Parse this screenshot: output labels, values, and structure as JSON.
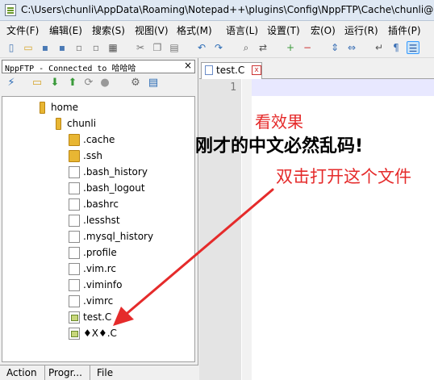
{
  "window": {
    "title": "C:\\Users\\chunli\\AppData\\Roaming\\Notepad++\\plugins\\Config\\NppFTP\\Cache\\chunli@1"
  },
  "menu": [
    "文件(F)",
    "编辑(E)",
    "搜索(S)",
    "视图(V)",
    "格式(M)",
    "语言(L)",
    "设置(T)",
    "宏(O)",
    "运行(R)",
    "插件(P)"
  ],
  "toolbar_icons": [
    "new-file-icon",
    "open-file-icon",
    "save-icon",
    "save-all-icon",
    "close-icon",
    "close-all-icon",
    "print-icon",
    "cut-icon",
    "copy-icon",
    "paste-icon",
    "undo-icon",
    "redo-icon",
    "find-icon",
    "replace-icon",
    "zoom-in-icon",
    "zoom-out-icon",
    "sync-vertical-icon",
    "sync-horizontal-icon",
    "word-wrap-icon",
    "show-all-chars-icon",
    "indent-guide-icon"
  ],
  "ftp_panel": {
    "title": "NppFTP - Connected to 哈哈哈",
    "close_glyph": "×",
    "toolbar_icons": [
      "connect-icon",
      "folder-open-icon",
      "download-icon",
      "upload-icon",
      "refresh-icon",
      "abort-icon",
      "settings-icon",
      "messages-icon"
    ],
    "tree": [
      {
        "label": "home",
        "kind": "folder",
        "depth": 0
      },
      {
        "label": "chunli",
        "kind": "folder",
        "depth": 1
      },
      {
        "label": ".cache",
        "kind": "folder",
        "depth": 2
      },
      {
        "label": ".ssh",
        "kind": "folder",
        "depth": 2
      },
      {
        "label": ".bash_history",
        "kind": "file",
        "depth": 2
      },
      {
        "label": ".bash_logout",
        "kind": "file",
        "depth": 2
      },
      {
        "label": ".bashrc",
        "kind": "file",
        "depth": 2
      },
      {
        "label": ".lesshst",
        "kind": "file",
        "depth": 2
      },
      {
        "label": ".mysql_history",
        "kind": "file",
        "depth": 2
      },
      {
        "label": ".profile",
        "kind": "file",
        "depth": 2
      },
      {
        "label": ".vim.rc",
        "kind": "file",
        "depth": 2
      },
      {
        "label": ".viminfo",
        "kind": "file",
        "depth": 2
      },
      {
        "label": ".vimrc",
        "kind": "file",
        "depth": 2
      },
      {
        "label": "test.C",
        "kind": "doc",
        "depth": 2
      },
      {
        "label": "♦X♦.C",
        "kind": "doc",
        "depth": 2
      }
    ],
    "bottom_tabs": [
      "Action",
      "Progr...",
      "File"
    ]
  },
  "editor": {
    "tab_label": "test.C",
    "tab_close": "x",
    "line_numbers": [
      "1"
    ]
  },
  "annotations": {
    "note1": "看效果",
    "note2": "刚才的中文必然乱码!",
    "note3": "双击打开这个文件",
    "arrow_color": "#e52b2b"
  }
}
